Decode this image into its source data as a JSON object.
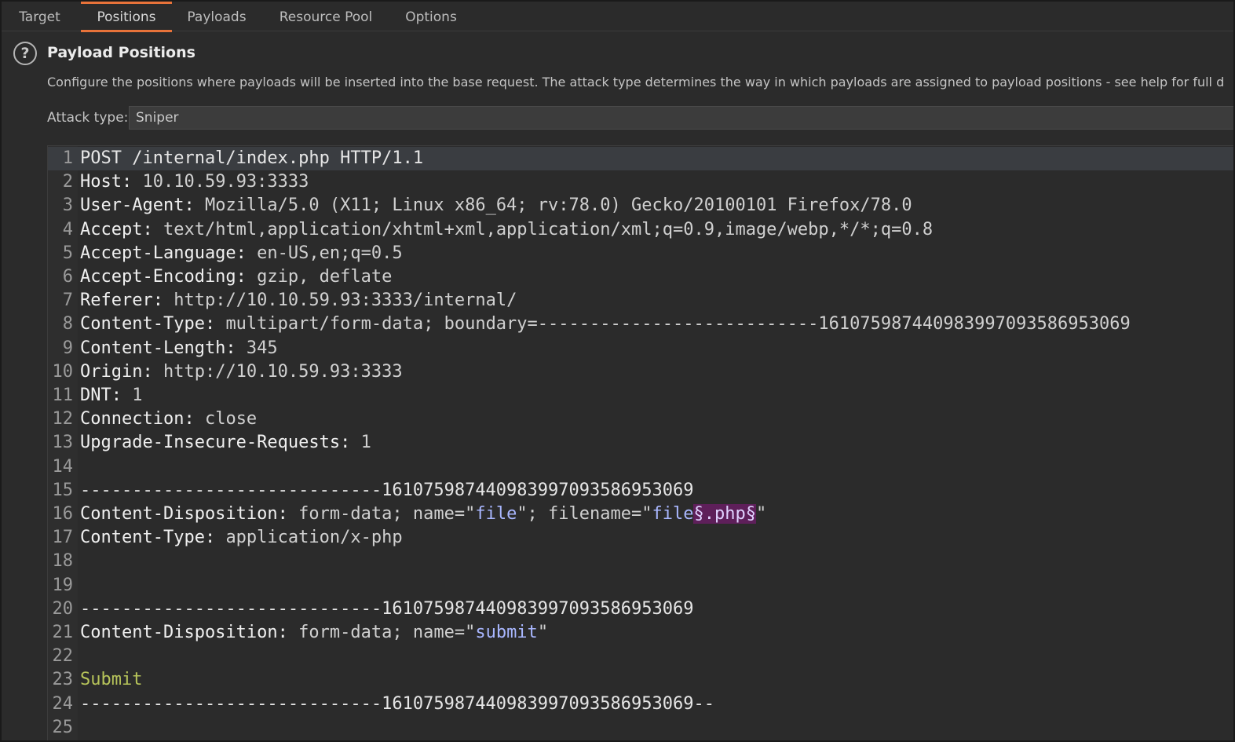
{
  "tabs": [
    {
      "label": "Target"
    },
    {
      "label": "Positions",
      "active": true
    },
    {
      "label": "Payloads"
    },
    {
      "label": "Resource Pool"
    },
    {
      "label": "Options"
    }
  ],
  "section": {
    "help_icon": "?",
    "title": "Payload Positions",
    "description": "Configure the positions where payloads will be inserted into the base request. The attack type determines the way in which payloads are assigned to payload positions - see help for full d"
  },
  "attack_type": {
    "label": "Attack type:",
    "value": "Sniper"
  },
  "request_lines": [
    {
      "n": "1",
      "parts": [
        {
          "t": "POST /internal/index.php HTTP/1.1",
          "c": "plain"
        }
      ]
    },
    {
      "n": "2",
      "parts": [
        {
          "t": "Host: ",
          "c": "hname"
        },
        {
          "t": "10.10.59.93:3333",
          "c": "hval"
        }
      ]
    },
    {
      "n": "3",
      "parts": [
        {
          "t": "User-Agent: ",
          "c": "hname"
        },
        {
          "t": "Mozilla/5.0 (X11; Linux x86_64; rv:78.0) Gecko/20100101 Firefox/78.0",
          "c": "hval"
        }
      ]
    },
    {
      "n": "4",
      "parts": [
        {
          "t": "Accept: ",
          "c": "hname"
        },
        {
          "t": "text/html,application/xhtml+xml,application/xml;q=0.9,image/webp,*/*;q=0.8",
          "c": "hval"
        }
      ]
    },
    {
      "n": "5",
      "parts": [
        {
          "t": "Accept-Language: ",
          "c": "hname"
        },
        {
          "t": "en-US,en;q=0.5",
          "c": "hval"
        }
      ]
    },
    {
      "n": "6",
      "parts": [
        {
          "t": "Accept-Encoding: ",
          "c": "hname"
        },
        {
          "t": "gzip, deflate",
          "c": "hval"
        }
      ]
    },
    {
      "n": "7",
      "parts": [
        {
          "t": "Referer: ",
          "c": "hname"
        },
        {
          "t": "http://10.10.59.93:3333/internal/",
          "c": "hval"
        }
      ]
    },
    {
      "n": "8",
      "parts": [
        {
          "t": "Content-Type: ",
          "c": "hname"
        },
        {
          "t": "multipart/form-data; boundary=---------------------------161075987440983997093586953069",
          "c": "hval"
        }
      ]
    },
    {
      "n": "9",
      "parts": [
        {
          "t": "Content-Length: ",
          "c": "hname"
        },
        {
          "t": "345",
          "c": "hval"
        }
      ]
    },
    {
      "n": "10",
      "parts": [
        {
          "t": "Origin: ",
          "c": "hname"
        },
        {
          "t": "http://10.10.59.93:3333",
          "c": "hval"
        }
      ]
    },
    {
      "n": "11",
      "parts": [
        {
          "t": "DNT: ",
          "c": "hname"
        },
        {
          "t": "1",
          "c": "hval"
        }
      ]
    },
    {
      "n": "12",
      "parts": [
        {
          "t": "Connection: ",
          "c": "hname"
        },
        {
          "t": "close",
          "c": "hval"
        }
      ]
    },
    {
      "n": "13",
      "parts": [
        {
          "t": "Upgrade-Insecure-Requests: ",
          "c": "hname"
        },
        {
          "t": "1",
          "c": "hval"
        }
      ]
    },
    {
      "n": "14",
      "parts": []
    },
    {
      "n": "15",
      "parts": [
        {
          "t": "-----------------------------161075987440983997093586953069",
          "c": "plain"
        }
      ]
    },
    {
      "n": "16",
      "parts": [
        {
          "t": "Content-Disposition: ",
          "c": "hname"
        },
        {
          "t": "form-data; name=\"",
          "c": "hval"
        },
        {
          "t": "file",
          "c": "qval"
        },
        {
          "t": "\"; filename=\"",
          "c": "hval"
        },
        {
          "t": "file",
          "c": "qval"
        },
        {
          "t": "§.php§",
          "c": "payload"
        },
        {
          "t": "\"",
          "c": "hval"
        }
      ]
    },
    {
      "n": "17",
      "parts": [
        {
          "t": "Content-Type: ",
          "c": "hname"
        },
        {
          "t": "application/x-php",
          "c": "hval"
        }
      ]
    },
    {
      "n": "18",
      "parts": []
    },
    {
      "n": "19",
      "parts": []
    },
    {
      "n": "20",
      "parts": [
        {
          "t": "-----------------------------161075987440983997093586953069",
          "c": "plain"
        }
      ]
    },
    {
      "n": "21",
      "parts": [
        {
          "t": "Content-Disposition: ",
          "c": "hname"
        },
        {
          "t": "form-data; name=\"",
          "c": "hval"
        },
        {
          "t": "submit",
          "c": "qval"
        },
        {
          "t": "\"",
          "c": "hval"
        }
      ]
    },
    {
      "n": "22",
      "parts": []
    },
    {
      "n": "23",
      "parts": [
        {
          "t": "Submit",
          "c": "body-text"
        }
      ]
    },
    {
      "n": "24",
      "parts": [
        {
          "t": "-----------------------------161075987440983997093586953069--",
          "c": "plain"
        }
      ]
    },
    {
      "n": "25",
      "parts": []
    }
  ],
  "colors": {
    "accent": "#e8733a",
    "payload_highlight": "#5e1f5a",
    "string_value": "#a9b7ff",
    "body_text": "#b7c45a"
  }
}
